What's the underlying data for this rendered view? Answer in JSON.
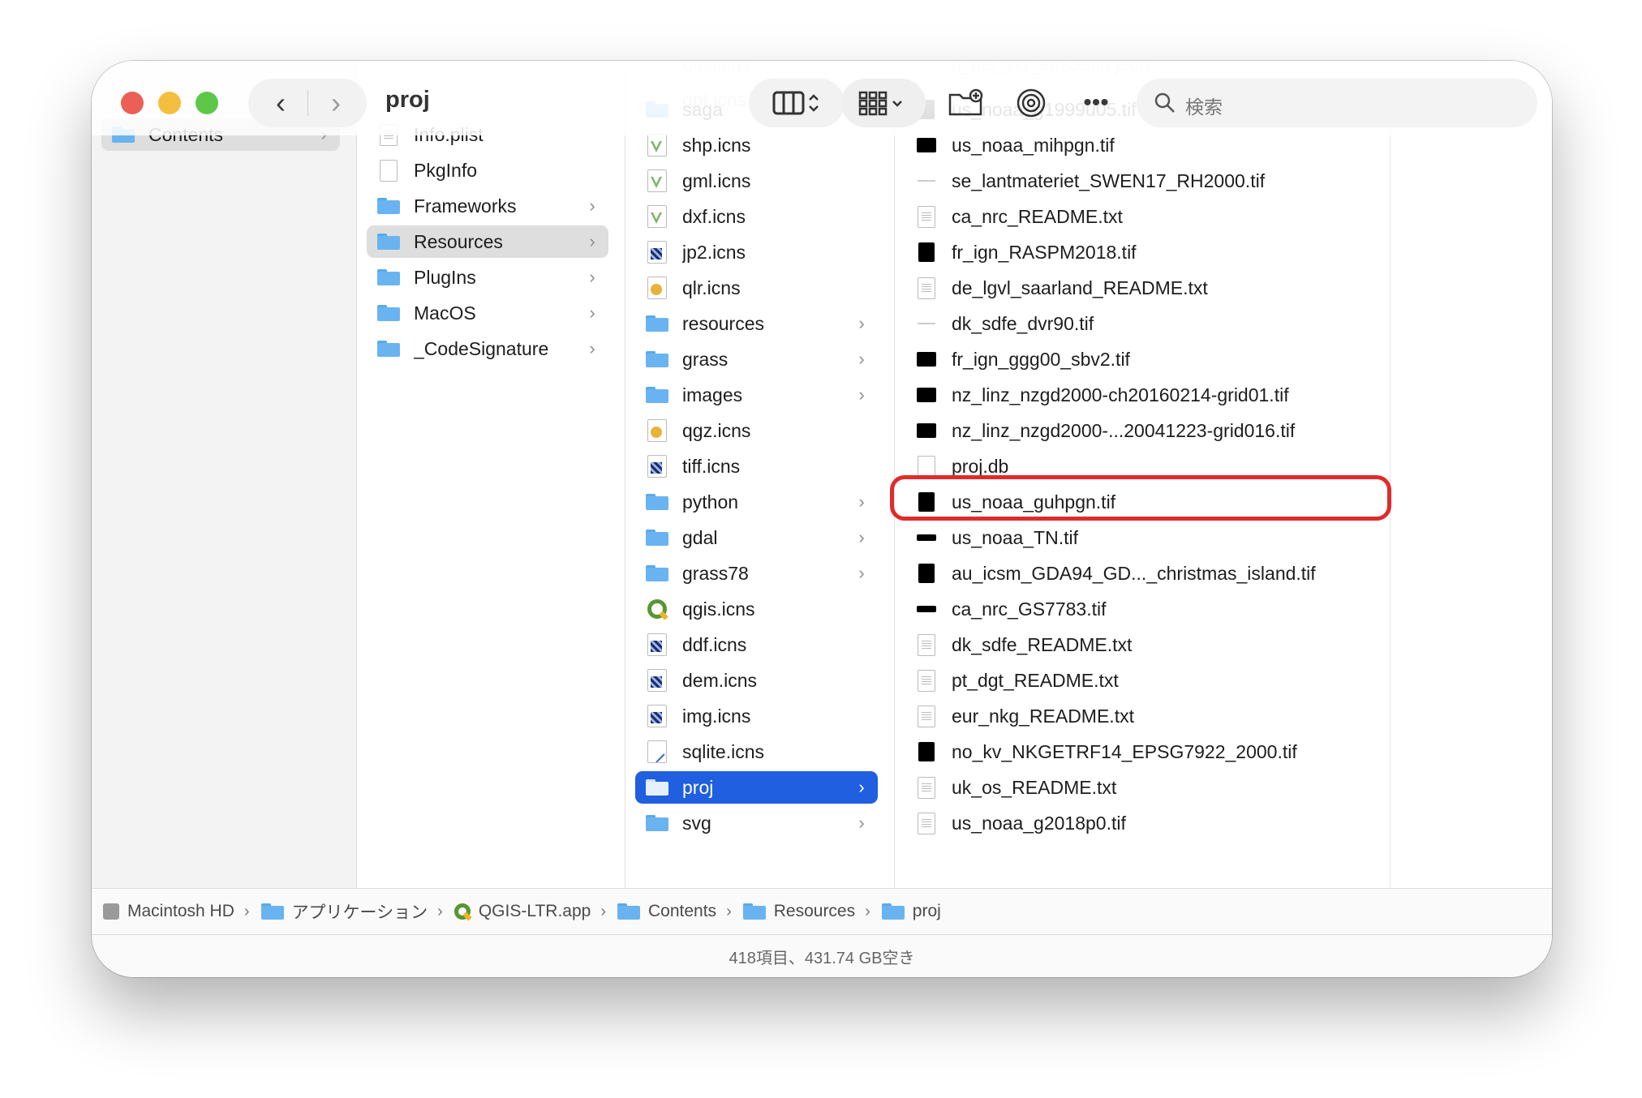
{
  "window": {
    "title": "proj",
    "search_placeholder": "検索",
    "status": "418項目、431.74 GB空き"
  },
  "colors": {
    "close": "#ec5f56",
    "minimize": "#f4bf3f",
    "zoom": "#5dc847",
    "accent": "#1f5fe0",
    "highlight": "#e02b2b"
  },
  "columns": {
    "col1": [
      {
        "label": "Contents",
        "icon": "folder",
        "chevron": true,
        "state": "grey"
      }
    ],
    "col2": [
      {
        "label": "Info.plist",
        "icon": "plist-doc",
        "chevron": false
      },
      {
        "label": "PkgInfo",
        "icon": "doc",
        "chevron": false
      },
      {
        "label": "Frameworks",
        "icon": "folder",
        "chevron": true
      },
      {
        "label": "Resources",
        "icon": "folder",
        "chevron": true,
        "state": "grey"
      },
      {
        "label": "PlugIns",
        "icon": "folder",
        "chevron": true
      },
      {
        "label": "MacOS",
        "icon": "folder",
        "chevron": true
      },
      {
        "label": "_CodeSignature",
        "icon": "folder",
        "chevron": true
      }
    ],
    "col3_ghost": [
      "qml.icns",
      "qpt.icns"
    ],
    "col3": [
      {
        "label": "saga",
        "icon": "folder",
        "chevron": true
      },
      {
        "label": "shp.icns",
        "icon": "icns-vector",
        "chevron": false
      },
      {
        "label": "gml.icns",
        "icon": "icns-vector",
        "chevron": false
      },
      {
        "label": "dxf.icns",
        "icon": "icns-vector",
        "chevron": false
      },
      {
        "label": "jp2.icns",
        "icon": "icns-raster",
        "chevron": false
      },
      {
        "label": "qlr.icns",
        "icon": "icns-qlr",
        "chevron": false
      },
      {
        "label": "resources",
        "icon": "folder",
        "chevron": true
      },
      {
        "label": "grass",
        "icon": "folder",
        "chevron": true
      },
      {
        "label": "images",
        "icon": "folder",
        "chevron": true
      },
      {
        "label": "qgz.icns",
        "icon": "icns-qlr",
        "chevron": false
      },
      {
        "label": "tiff.icns",
        "icon": "icns-raster",
        "chevron": false
      },
      {
        "label": "python",
        "icon": "folder",
        "chevron": true
      },
      {
        "label": "gdal",
        "icon": "folder",
        "chevron": true
      },
      {
        "label": "grass78",
        "icon": "folder",
        "chevron": true
      },
      {
        "label": "qgis.icns",
        "icon": "qgis",
        "chevron": false
      },
      {
        "label": "ddf.icns",
        "icon": "icns-raster",
        "chevron": false
      },
      {
        "label": "dem.icns",
        "icon": "icns-raster",
        "chevron": false
      },
      {
        "label": "img.icns",
        "icon": "icns-raster",
        "chevron": false
      },
      {
        "label": "sqlite.icns",
        "icon": "icns-pen",
        "chevron": false
      },
      {
        "label": "proj",
        "icon": "folder",
        "chevron": true,
        "state": "blue"
      },
      {
        "label": "svg",
        "icon": "folder",
        "chevron": true
      }
    ],
    "col4_ghost": [
      "fi_nls_vki_etrs35fin.json"
    ],
    "col4": [
      {
        "label": "us_noaa_g1999u05.tif",
        "icon": "black"
      },
      {
        "label": "us_noaa_mihpgn.tif",
        "icon": "black-wide"
      },
      {
        "label": "se_lantmateriet_SWEN17_RH2000.tif",
        "icon": "thin"
      },
      {
        "label": "ca_nrc_README.txt",
        "icon": "text-doc"
      },
      {
        "label": "fr_ign_RASPM2018.tif",
        "icon": "black"
      },
      {
        "label": "de_lgvl_saarland_README.txt",
        "icon": "text-doc"
      },
      {
        "label": "dk_sdfe_dvr90.tif",
        "icon": "thin"
      },
      {
        "label": "fr_ign_ggg00_sbv2.tif",
        "icon": "black-wide"
      },
      {
        "label": "nz_linz_nzgd2000-ch20160214-grid01.tif",
        "icon": "black-wide"
      },
      {
        "label": "nz_linz_nzgd2000-...20041223-grid016.tif",
        "icon": "black-wide"
      },
      {
        "label": "proj.db",
        "icon": "doc"
      },
      {
        "label": "us_noaa_guhpgn.tif",
        "icon": "black"
      },
      {
        "label": "us_noaa_TN.tif",
        "icon": "black-flat"
      },
      {
        "label": "au_icsm_GDA94_GD..._christmas_island.tif",
        "icon": "black"
      },
      {
        "label": "ca_nrc_GS7783.tif",
        "icon": "black-flat"
      },
      {
        "label": "dk_sdfe_README.txt",
        "icon": "text-doc"
      },
      {
        "label": "pt_dgt_README.txt",
        "icon": "text-doc"
      },
      {
        "label": "eur_nkg_README.txt",
        "icon": "text-doc"
      },
      {
        "label": "no_kv_NKGETRF14_EPSG7922_2000.tif",
        "icon": "black"
      },
      {
        "label": "uk_os_README.txt",
        "icon": "text-doc"
      },
      {
        "label": "us_noaa_g2018p0.tif",
        "icon": "text-doc"
      }
    ]
  },
  "pathbar": [
    {
      "label": "Macintosh HD",
      "icon": "disk"
    },
    {
      "label": "アプリケーション",
      "icon": "apps-folder"
    },
    {
      "label": "QGIS-LTR.app",
      "icon": "qgis"
    },
    {
      "label": "Contents",
      "icon": "folder"
    },
    {
      "label": "Resources",
      "icon": "folder"
    },
    {
      "label": "proj",
      "icon": "folder"
    }
  ]
}
